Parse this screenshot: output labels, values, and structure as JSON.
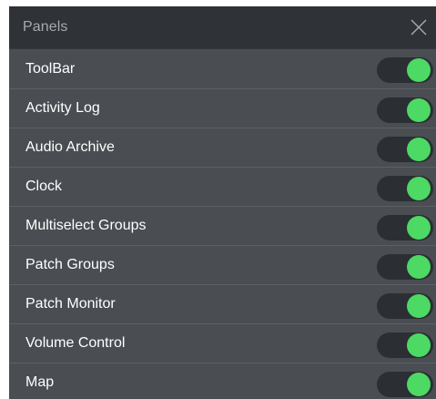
{
  "panel": {
    "title": "Panels",
    "close_icon": "close-icon",
    "accent_color": "#4cd964",
    "items": [
      {
        "label": "ToolBar",
        "enabled": true
      },
      {
        "label": "Activity Log",
        "enabled": true
      },
      {
        "label": "Audio Archive",
        "enabled": true
      },
      {
        "label": "Clock",
        "enabled": true
      },
      {
        "label": "Multiselect Groups",
        "enabled": true
      },
      {
        "label": "Patch Groups",
        "enabled": true
      },
      {
        "label": "Patch Monitor",
        "enabled": true
      },
      {
        "label": "Volume Control",
        "enabled": true
      },
      {
        "label": "Map",
        "enabled": true
      }
    ]
  }
}
